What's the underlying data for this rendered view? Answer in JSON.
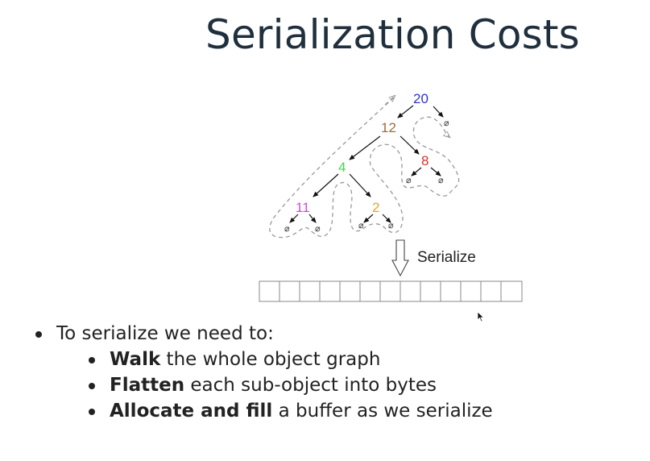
{
  "slide": {
    "title": "Serialization Costs"
  },
  "diagram": {
    "nodes": [
      {
        "id": "n20",
        "label": "20",
        "color": "#2b35c8"
      },
      {
        "id": "n12",
        "label": "12",
        "color": "#a06a3c"
      },
      {
        "id": "n4",
        "label": "4",
        "color": "#43d84a"
      },
      {
        "id": "n8",
        "label": "8",
        "color": "#d6332b"
      },
      {
        "id": "n11",
        "label": "11",
        "color": "#d04bd6"
      },
      {
        "id": "n2",
        "label": "2",
        "color": "#f0a020"
      }
    ],
    "edges": [
      [
        "n20",
        "n12"
      ],
      [
        "n20",
        "null-20"
      ],
      [
        "n12",
        "n4"
      ],
      [
        "n12",
        "n8"
      ],
      [
        "n4",
        "n11"
      ],
      [
        "n4",
        "n2"
      ],
      [
        "n8",
        "null-8a"
      ],
      [
        "n8",
        "null-8b"
      ],
      [
        "n11",
        "null-11a"
      ],
      [
        "n11",
        "null-11b"
      ],
      [
        "n2",
        "null-2a"
      ],
      [
        "n2",
        "null-2b"
      ]
    ],
    "null_symbol": "⌀",
    "serialize_label": "Serialize",
    "buffer_cells": 13
  },
  "bullets": {
    "main": "To serialize we need to:",
    "items": [
      {
        "bold": "Walk",
        "rest": " the whole object graph"
      },
      {
        "bold": "Flatten",
        "rest": " each sub-object into bytes"
      },
      {
        "bold": "Allocate and fill",
        "rest": " a buffer as we serialize"
      }
    ]
  },
  "colors": {
    "title": "#1f2f3d",
    "text": "#222222",
    "dashed_path": "#999999"
  }
}
